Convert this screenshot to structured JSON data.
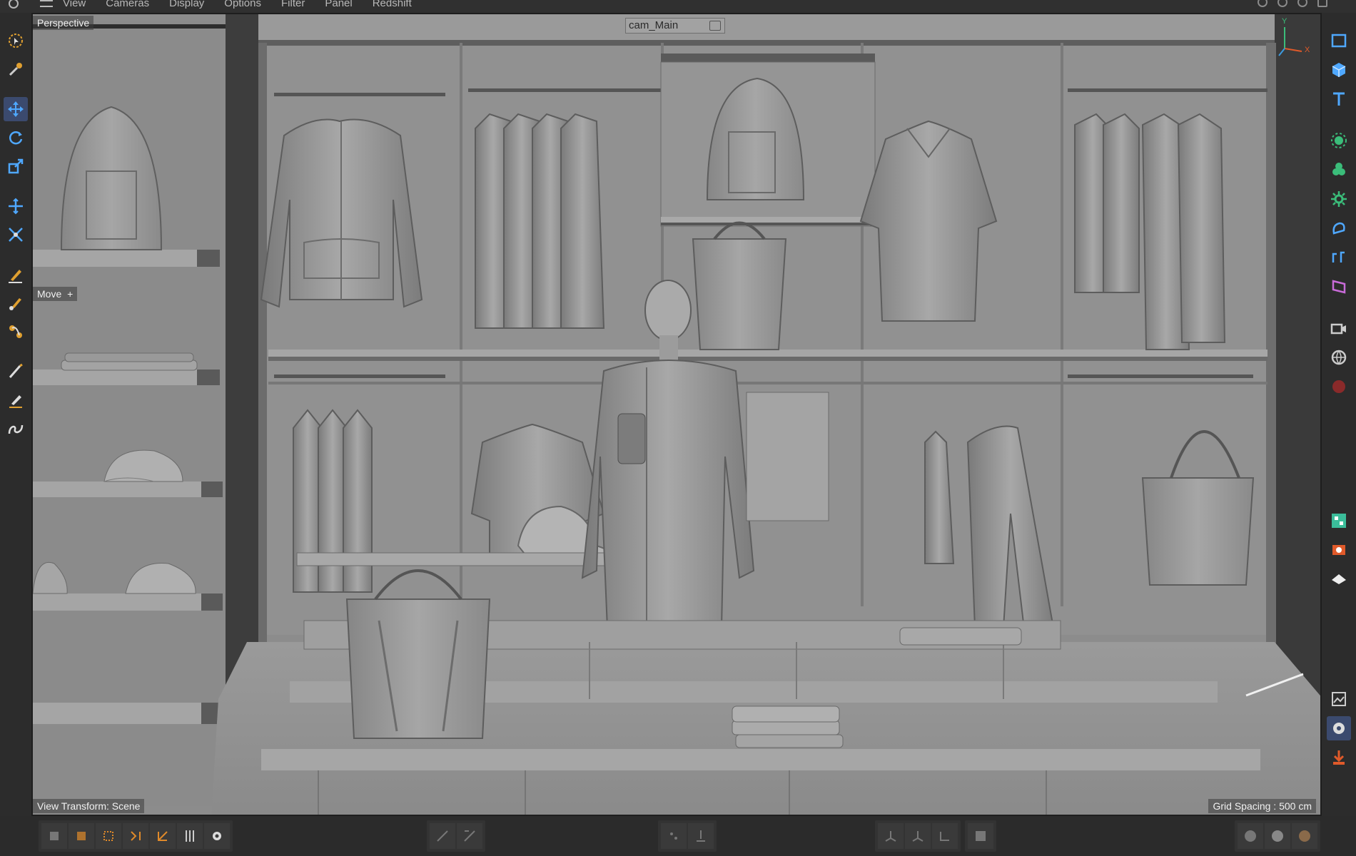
{
  "menu": {
    "items": [
      "View",
      "Cameras",
      "Display",
      "Options",
      "Filter",
      "Panel",
      "Redshift"
    ]
  },
  "viewport": {
    "perspective_label": "Perspective",
    "camera_label": "cam_Main",
    "tool_label": "Move",
    "view_transform_label": "View Transform: Scene",
    "grid_spacing_label": "Grid Spacing : 500 cm"
  },
  "axis": {
    "x": "X",
    "y": "Y"
  },
  "colors": {
    "viewport_bg": "#8e8e8e",
    "active_tool": "#3b4a6e",
    "accent_blue": "#3b9ae0",
    "accent_green": "#3bbd7a",
    "accent_orange": "#e05a2a"
  },
  "left_tools": [
    {
      "icon": "live-selection-icon"
    },
    {
      "icon": "magic-wand-icon"
    },
    {
      "icon": "move-icon",
      "active": true
    },
    {
      "icon": "rotate-icon"
    },
    {
      "icon": "scale-icon"
    },
    {
      "icon": "transform-icon"
    },
    {
      "icon": "placement-icon"
    },
    {
      "icon": "pen-icon"
    },
    {
      "icon": "brush-icon"
    },
    {
      "icon": "sculpt-icon"
    },
    {
      "icon": "paint-icon"
    },
    {
      "icon": "knife-icon"
    },
    {
      "icon": "spline-icon"
    }
  ],
  "right_tools": [
    {
      "icon": "plane-icon"
    },
    {
      "icon": "cube-icon"
    },
    {
      "icon": "text-icon"
    },
    {
      "icon": "generator-icon"
    },
    {
      "icon": "cloner-icon"
    },
    {
      "icon": "effector-icon"
    },
    {
      "icon": "deformer-icon"
    },
    {
      "icon": "field-icon"
    },
    {
      "icon": "volume-icon"
    },
    {
      "icon": "camera-icon"
    },
    {
      "icon": "environment-icon"
    },
    {
      "icon": "material-icon"
    },
    {
      "icon": "asset-browser-icon"
    },
    {
      "icon": "render-icon"
    },
    {
      "icon": "light-icon"
    },
    {
      "icon": "picture-viewer-icon"
    },
    {
      "icon": "render-settings-icon"
    },
    {
      "icon": "export-icon"
    }
  ]
}
